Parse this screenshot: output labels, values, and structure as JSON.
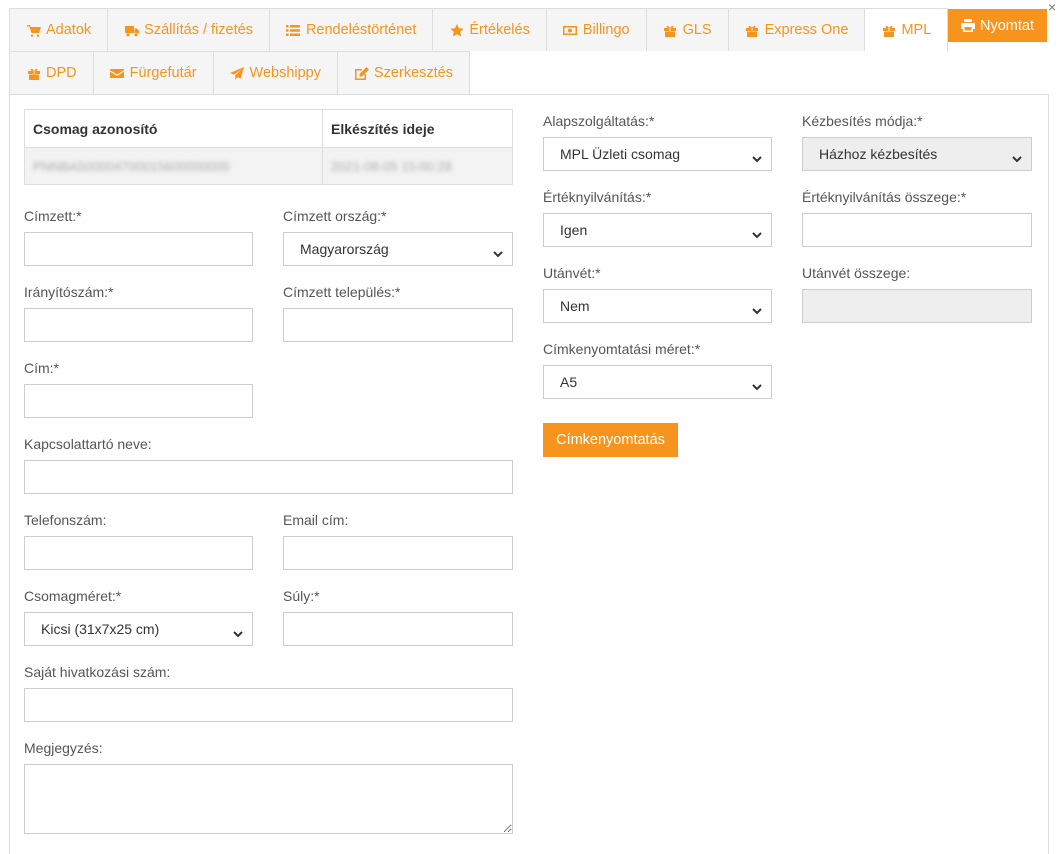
{
  "tabs_row1": [
    {
      "label": "Adatok",
      "icon": "cart-icon",
      "name": "tab-adatok"
    },
    {
      "label": "Szállítás / fizetés",
      "icon": "truck-icon",
      "name": "tab-szallitas"
    },
    {
      "label": "Rendeléstörténet",
      "icon": "list-icon",
      "name": "tab-rendelestortenet"
    },
    {
      "label": "Értékelés",
      "icon": "star-icon",
      "name": "tab-ertekeles"
    },
    {
      "label": "Billingo",
      "icon": "money-icon",
      "name": "tab-billingo"
    },
    {
      "label": "GLS",
      "icon": "gift-icon",
      "name": "tab-gls"
    },
    {
      "label": "Express One",
      "icon": "gift-icon",
      "name": "tab-express-one"
    },
    {
      "label": "MPL",
      "icon": "gift-icon",
      "name": "tab-mpl"
    }
  ],
  "tabs_row2": [
    {
      "label": "DPD",
      "icon": "gift-icon",
      "name": "tab-dpd"
    },
    {
      "label": "Fürgefutár",
      "icon": "envelope-icon",
      "name": "tab-furgefutar"
    },
    {
      "label": "Webshippy",
      "icon": "paper-plane-icon",
      "name": "tab-webshippy"
    },
    {
      "label": "Szerkesztés",
      "icon": "edit-icon",
      "name": "tab-szerkesztes"
    }
  ],
  "active_tab": "MPL",
  "print_button": {
    "label": "Nyomtat",
    "icon": "print-icon"
  },
  "close_glyph": "×",
  "package_table": {
    "headers": [
      "Csomag azonosító",
      "Elkészítés ideje"
    ],
    "row": [
      "PNNBA500004700015600000000",
      "2021-08-05 15:00:28"
    ]
  },
  "form": {
    "recipient": {
      "label": "Címzett:*",
      "value": ""
    },
    "country": {
      "label": "Címzett ország:*",
      "value": "Magyarország"
    },
    "zip": {
      "label": "Irányítószám:*",
      "value": ""
    },
    "city": {
      "label": "Címzett település:*",
      "value": ""
    },
    "address": {
      "label": "Cím:*",
      "value": ""
    },
    "contact": {
      "label": "Kapcsolattartó neve:",
      "value": ""
    },
    "phone": {
      "label": "Telefonszám:",
      "value": ""
    },
    "email": {
      "label": "Email cím:",
      "value": ""
    },
    "package_size": {
      "label": "Csomagméret:*",
      "value": "Kicsi (31x7x25 cm)"
    },
    "weight": {
      "label": "Súly:*",
      "value": ""
    },
    "reference": {
      "label": "Saját hivatkozási szám:",
      "value": ""
    },
    "note": {
      "label": "Megjegyzés:",
      "value": ""
    },
    "base_service": {
      "label": "Alapszolgáltatás:*",
      "value": "MPL Üzleti csomag"
    },
    "delivery_mode": {
      "label": "Kézbesítés módja:*",
      "value": "Házhoz kézbesítés"
    },
    "declared_value": {
      "label": "Értéknyilvánítás:*",
      "value": "Igen"
    },
    "declared_amount": {
      "label": "Értéknyilvánítás összege:*",
      "value": ""
    },
    "cod": {
      "label": "Utánvét:*",
      "value": "Nem"
    },
    "cod_amount": {
      "label": "Utánvét összege:",
      "value": ""
    },
    "label_size": {
      "label": "Címkenyomtatási méret:*",
      "value": "A5"
    }
  },
  "label_print_button": "Címkenyomtatás",
  "colors": {
    "accent": "#f7941d",
    "border": "#dddddd",
    "disabled": "#eeeeee"
  }
}
